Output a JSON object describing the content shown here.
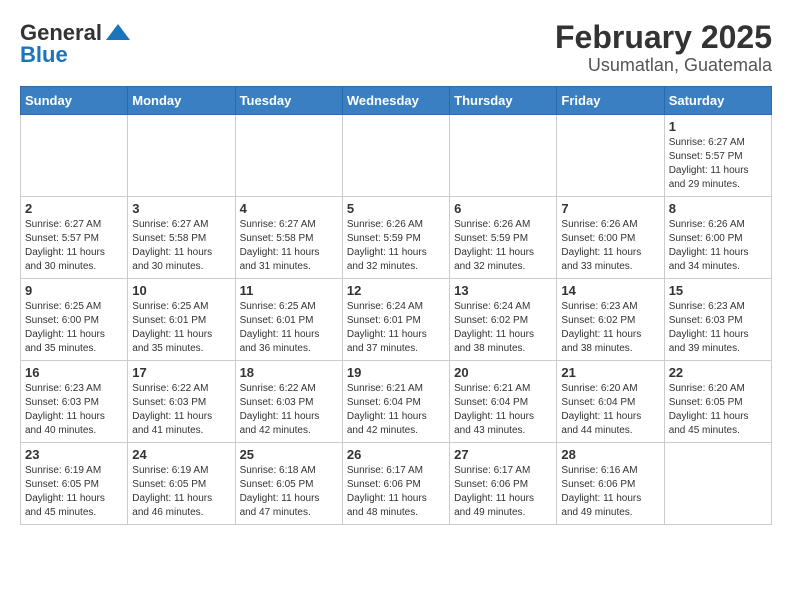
{
  "header": {
    "logo_line1": "General",
    "logo_line2": "Blue",
    "title": "February 2025",
    "subtitle": "Usumatlan, Guatemala"
  },
  "weekdays": [
    "Sunday",
    "Monday",
    "Tuesday",
    "Wednesday",
    "Thursday",
    "Friday",
    "Saturday"
  ],
  "weeks": [
    [
      {
        "day": "",
        "info": ""
      },
      {
        "day": "",
        "info": ""
      },
      {
        "day": "",
        "info": ""
      },
      {
        "day": "",
        "info": ""
      },
      {
        "day": "",
        "info": ""
      },
      {
        "day": "",
        "info": ""
      },
      {
        "day": "1",
        "info": "Sunrise: 6:27 AM\nSunset: 5:57 PM\nDaylight: 11 hours and 29 minutes."
      }
    ],
    [
      {
        "day": "2",
        "info": "Sunrise: 6:27 AM\nSunset: 5:57 PM\nDaylight: 11 hours and 30 minutes."
      },
      {
        "day": "3",
        "info": "Sunrise: 6:27 AM\nSunset: 5:58 PM\nDaylight: 11 hours and 30 minutes."
      },
      {
        "day": "4",
        "info": "Sunrise: 6:27 AM\nSunset: 5:58 PM\nDaylight: 11 hours and 31 minutes."
      },
      {
        "day": "5",
        "info": "Sunrise: 6:26 AM\nSunset: 5:59 PM\nDaylight: 11 hours and 32 minutes."
      },
      {
        "day": "6",
        "info": "Sunrise: 6:26 AM\nSunset: 5:59 PM\nDaylight: 11 hours and 32 minutes."
      },
      {
        "day": "7",
        "info": "Sunrise: 6:26 AM\nSunset: 6:00 PM\nDaylight: 11 hours and 33 minutes."
      },
      {
        "day": "8",
        "info": "Sunrise: 6:26 AM\nSunset: 6:00 PM\nDaylight: 11 hours and 34 minutes."
      }
    ],
    [
      {
        "day": "9",
        "info": "Sunrise: 6:25 AM\nSunset: 6:00 PM\nDaylight: 11 hours and 35 minutes."
      },
      {
        "day": "10",
        "info": "Sunrise: 6:25 AM\nSunset: 6:01 PM\nDaylight: 11 hours and 35 minutes."
      },
      {
        "day": "11",
        "info": "Sunrise: 6:25 AM\nSunset: 6:01 PM\nDaylight: 11 hours and 36 minutes."
      },
      {
        "day": "12",
        "info": "Sunrise: 6:24 AM\nSunset: 6:01 PM\nDaylight: 11 hours and 37 minutes."
      },
      {
        "day": "13",
        "info": "Sunrise: 6:24 AM\nSunset: 6:02 PM\nDaylight: 11 hours and 38 minutes."
      },
      {
        "day": "14",
        "info": "Sunrise: 6:23 AM\nSunset: 6:02 PM\nDaylight: 11 hours and 38 minutes."
      },
      {
        "day": "15",
        "info": "Sunrise: 6:23 AM\nSunset: 6:03 PM\nDaylight: 11 hours and 39 minutes."
      }
    ],
    [
      {
        "day": "16",
        "info": "Sunrise: 6:23 AM\nSunset: 6:03 PM\nDaylight: 11 hours and 40 minutes."
      },
      {
        "day": "17",
        "info": "Sunrise: 6:22 AM\nSunset: 6:03 PM\nDaylight: 11 hours and 41 minutes."
      },
      {
        "day": "18",
        "info": "Sunrise: 6:22 AM\nSunset: 6:03 PM\nDaylight: 11 hours and 42 minutes."
      },
      {
        "day": "19",
        "info": "Sunrise: 6:21 AM\nSunset: 6:04 PM\nDaylight: 11 hours and 42 minutes."
      },
      {
        "day": "20",
        "info": "Sunrise: 6:21 AM\nSunset: 6:04 PM\nDaylight: 11 hours and 43 minutes."
      },
      {
        "day": "21",
        "info": "Sunrise: 6:20 AM\nSunset: 6:04 PM\nDaylight: 11 hours and 44 minutes."
      },
      {
        "day": "22",
        "info": "Sunrise: 6:20 AM\nSunset: 6:05 PM\nDaylight: 11 hours and 45 minutes."
      }
    ],
    [
      {
        "day": "23",
        "info": "Sunrise: 6:19 AM\nSunset: 6:05 PM\nDaylight: 11 hours and 45 minutes."
      },
      {
        "day": "24",
        "info": "Sunrise: 6:19 AM\nSunset: 6:05 PM\nDaylight: 11 hours and 46 minutes."
      },
      {
        "day": "25",
        "info": "Sunrise: 6:18 AM\nSunset: 6:05 PM\nDaylight: 11 hours and 47 minutes."
      },
      {
        "day": "26",
        "info": "Sunrise: 6:17 AM\nSunset: 6:06 PM\nDaylight: 11 hours and 48 minutes."
      },
      {
        "day": "27",
        "info": "Sunrise: 6:17 AM\nSunset: 6:06 PM\nDaylight: 11 hours and 49 minutes."
      },
      {
        "day": "28",
        "info": "Sunrise: 6:16 AM\nSunset: 6:06 PM\nDaylight: 11 hours and 49 minutes."
      },
      {
        "day": "",
        "info": ""
      }
    ]
  ]
}
